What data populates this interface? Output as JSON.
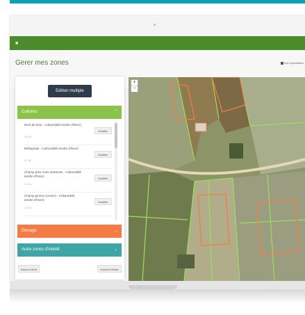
{
  "header": {
    "menu_icon": "menu-icon"
  },
  "page": {
    "title": "Gerer mes zones",
    "view_toggle": "Vue exploitation"
  },
  "panel": {
    "multi_edit_label": "Edition multiple",
    "sections": [
      {
        "label": "Cultures",
        "color": "#8bc34a"
      },
      {
        "label": "Elevage",
        "color": "#f47b44"
      },
      {
        "label": "Autre zones d'intérêt",
        "color": "#3fa6a8"
      }
    ],
    "items": [
      {
        "name": "Bord de lune - Culture(Blé tendre d'hiver)",
        "sub": "2,5 ha",
        "edit": "Modifier"
      },
      {
        "name": "Bellegrade - Culture(Blé tendre d'hiver)",
        "sub": "3,7 ha",
        "edit": "Modifier"
      },
      {
        "name": "Champ près moto antennes - Culture(Blé tendre d'hiver)",
        "sub": "1,4 ha",
        "edit": "Modifier"
      },
      {
        "name": "Champ pinson (centre) - Culture(Blé tendre d'hiver)",
        "sub": "2,4 ha",
        "edit": "Modifier"
      }
    ],
    "footer_left": "Nouvel élevé",
    "footer_right": "Importer fichier"
  },
  "map": {
    "zoom_in": "+",
    "zoom_out": "−"
  },
  "colors": {
    "brand": "#4c8b2b",
    "accent_top": "#0aa0b7",
    "selection": "#f47b44",
    "parcel_outline": "#9be05a"
  }
}
